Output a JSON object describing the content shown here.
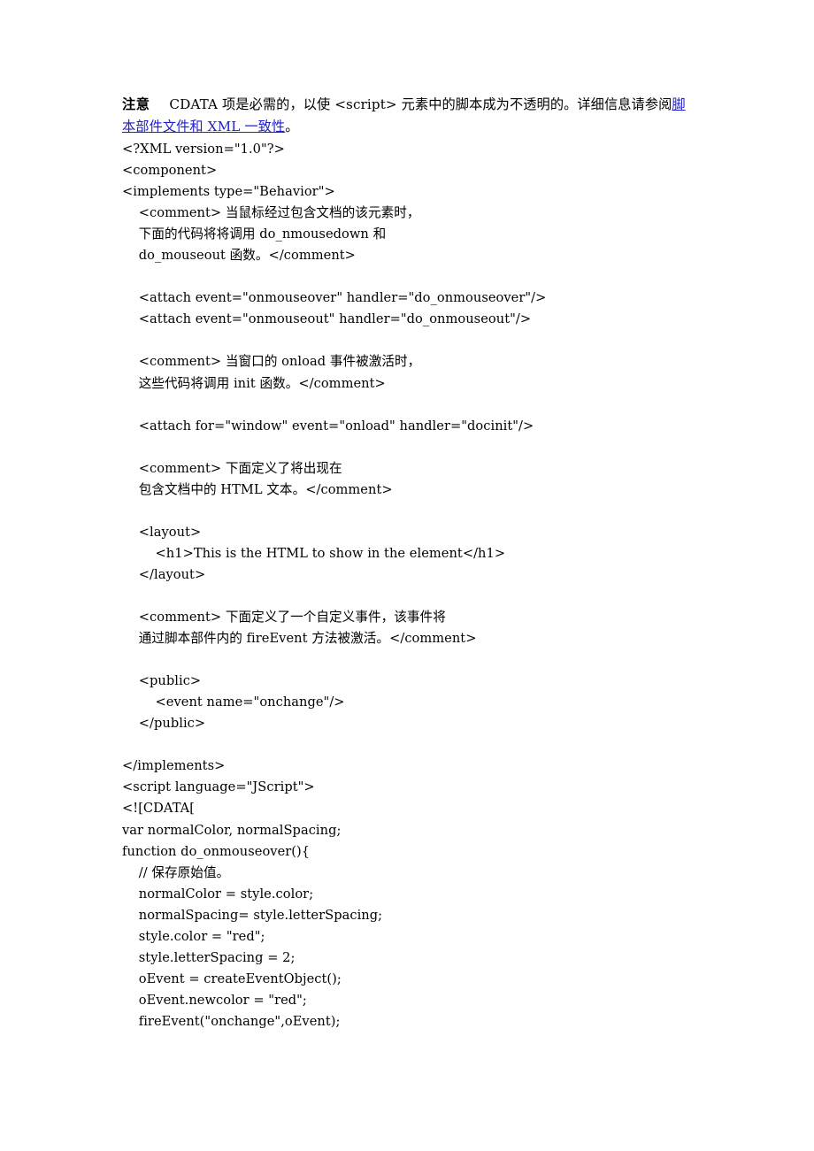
{
  "document": {
    "note": {
      "label": "注意",
      "text_before_link": "CDATA 项是必需的，以使 <script> 元素中的脚本成为不透明的。详细信息请参阅",
      "link_text": "脚本部件文件和 XML 一致性",
      "text_after_link": "。"
    },
    "code_lines": [
      "<?XML version=\"1.0\"?>",
      "<component>",
      "<implements type=\"Behavior\">",
      "    <comment> 当鼠标经过包含文档的该元素时，",
      "    下面的代码将将调用 do_nmousedown 和",
      "    do_mouseout 函数。</comment>",
      "",
      "    <attach event=\"onmouseover\" handler=\"do_onmouseover\"/>",
      "    <attach event=\"onmouseout\" handler=\"do_onmouseout\"/>",
      "",
      "    <comment> 当窗口的 onload 事件被激活时，",
      "    这些代码将调用 init 函数。</comment>",
      "",
      "    <attach for=\"window\" event=\"onload\" handler=\"docinit\"/>",
      "",
      "    <comment> 下面定义了将出现在",
      "    包含文档中的 HTML 文本。</comment>",
      "",
      "    <layout>",
      "        <h1>This is the HTML to show in the element</h1>",
      "    </layout>",
      "",
      "    <comment> 下面定义了一个自定义事件，该事件将",
      "    通过脚本部件内的 fireEvent 方法被激活。</comment>",
      "",
      "    <public>",
      "        <event name=\"onchange\"/>",
      "    </public>",
      "",
      "</implements>",
      "<script language=\"JScript\">",
      "<![CDATA[",
      "var normalColor, normalSpacing;",
      "function do_onmouseover(){",
      "    // 保存原始值。",
      "    normalColor = style.color;",
      "    normalSpacing= style.letterSpacing;",
      "    style.color = \"red\";",
      "    style.letterSpacing = 2;",
      "    oEvent = createEventObject();",
      "    oEvent.newcolor = \"red\";",
      "    fireEvent(\"onchange\",oEvent);"
    ]
  },
  "colors": {
    "background": "#ffffff",
    "text": "#000000",
    "link": "#2020cc"
  }
}
